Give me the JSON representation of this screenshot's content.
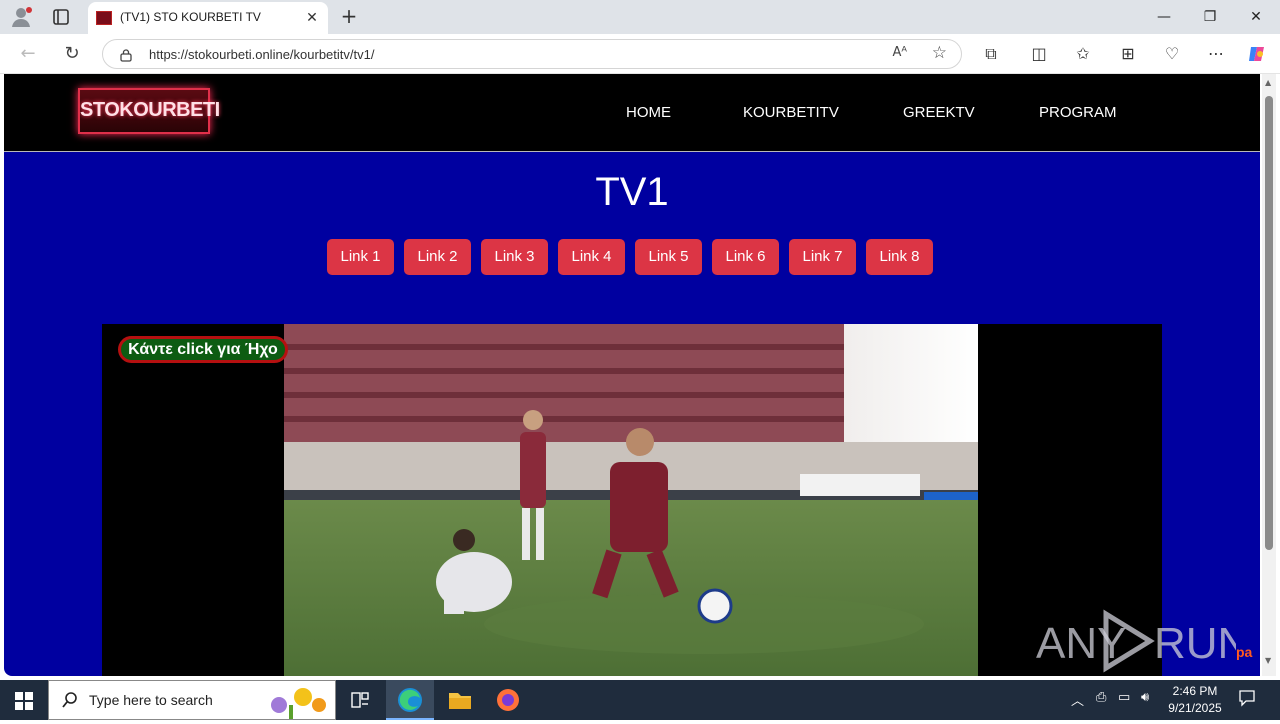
{
  "browser": {
    "tab_title": "(TV1) STO KOURBETI TV",
    "url": "https://stokourbeti.online/kourbetitv/tv1/",
    "read_aloud": "Aᴬ"
  },
  "site": {
    "logo_text": "STOKOURBETI",
    "menu": [
      "HOME",
      "KOURBETITV",
      "GREEKTV",
      "PROGRAM"
    ],
    "page_title": "TV1",
    "links": [
      "Link 1",
      "Link 2",
      "Link 3",
      "Link 4",
      "Link 5",
      "Link 6",
      "Link 7",
      "Link 8"
    ],
    "sound_button": "Κάντε click για Ήχο"
  },
  "watermark": {
    "left": "ANY",
    "right": "RUN",
    "tail": "pa"
  },
  "taskbar": {
    "search_placeholder": "Type here to search",
    "time": "2:46 PM",
    "date": "9/21/2025"
  },
  "colors": {
    "page_bg": "#0000a0",
    "link_button": "#dc3545",
    "header_bg": "#000000"
  }
}
